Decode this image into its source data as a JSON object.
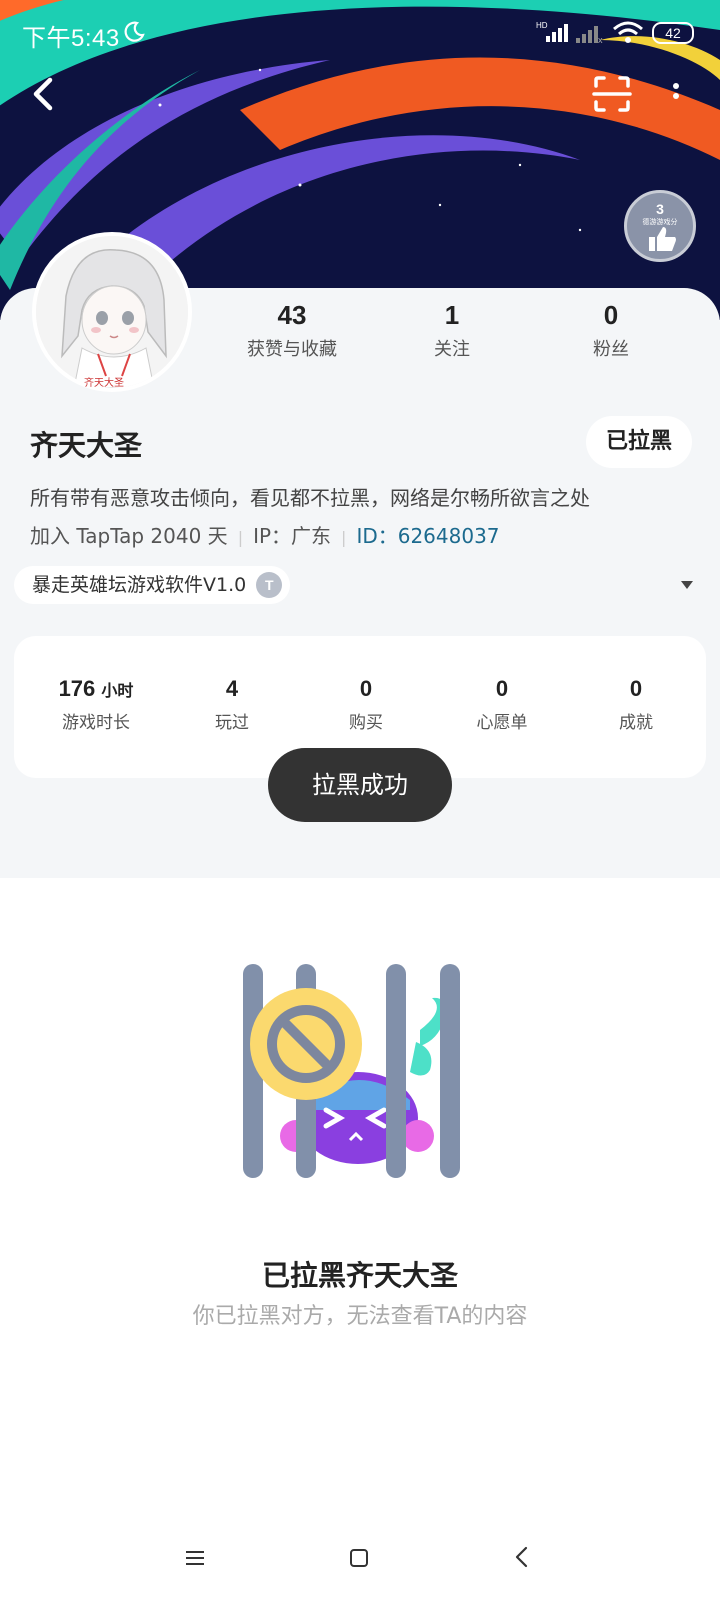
{
  "status_bar": {
    "time": "下午5:43",
    "battery": "42"
  },
  "profile": {
    "name": "齐天大圣",
    "blocked_label": "已拉黑",
    "bio": "所有带有恶意攻击倾向，看见都不拉黑，网络是尔畅所欲言之处",
    "joined": "加入 TapTap 2040 天",
    "ip": "IP：广东",
    "id": "ID：62648037",
    "badge_level": "3",
    "badge_caption": "德游游戏分",
    "avatar_caption": "齐天大圣"
  },
  "stats": [
    {
      "value": "43",
      "label": "获赞与收藏"
    },
    {
      "value": "1",
      "label": "关注"
    },
    {
      "value": "0",
      "label": "粉丝"
    }
  ],
  "game_chip": {
    "label": "暴走英雄坛游戏软件V1.0",
    "tag": "T"
  },
  "game_stats": [
    {
      "value": "176",
      "unit": "小时",
      "label": "游戏时长"
    },
    {
      "value": "4",
      "unit": "",
      "label": "玩过"
    },
    {
      "value": "0",
      "unit": "",
      "label": "购买"
    },
    {
      "value": "0",
      "unit": "",
      "label": "心愿单"
    },
    {
      "value": "0",
      "unit": "",
      "label": "成就"
    }
  ],
  "toast": "拉黑成功",
  "empty": {
    "title": "已拉黑齐天大圣",
    "desc": "你已拉黑对方，无法查看TA的内容"
  }
}
